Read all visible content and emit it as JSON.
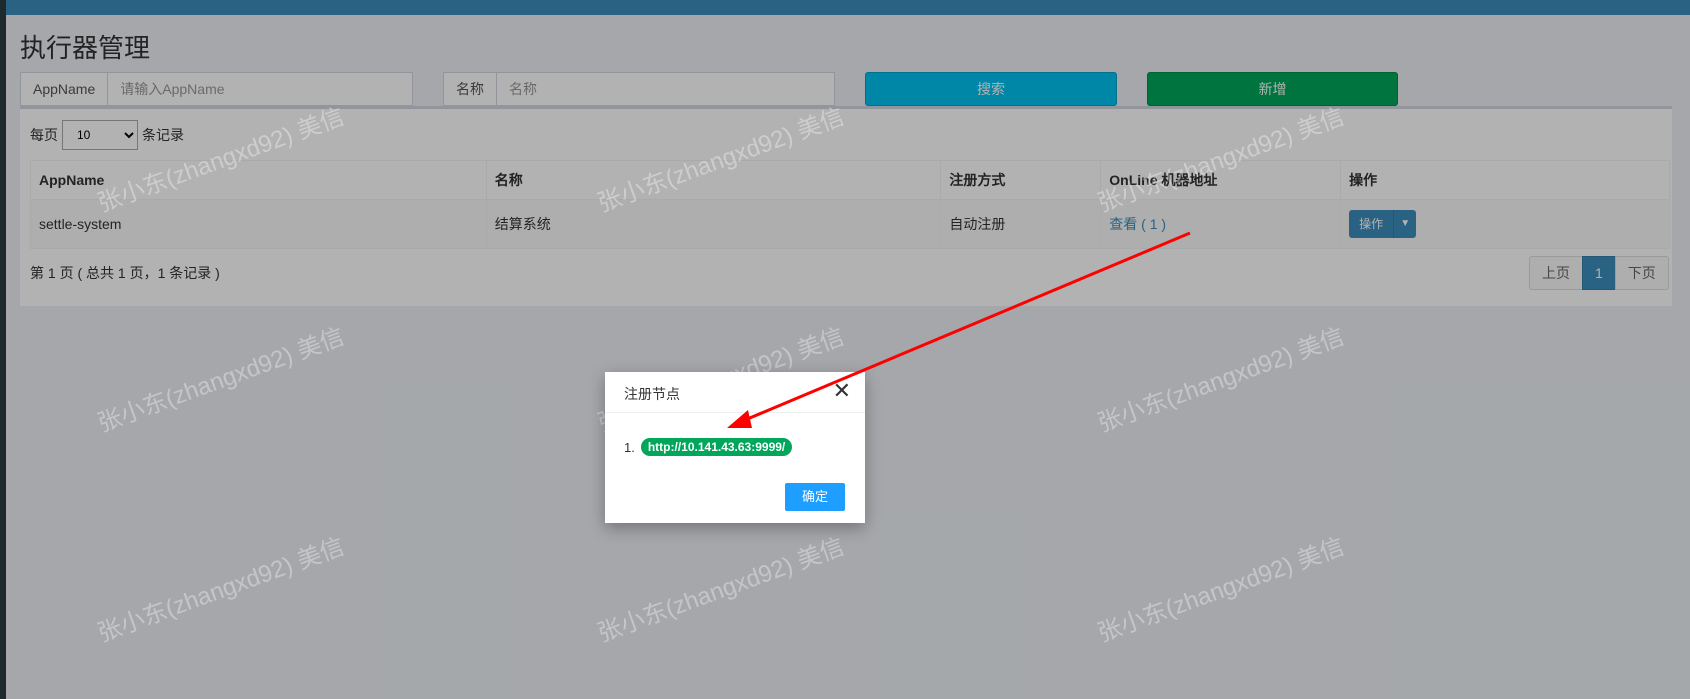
{
  "page_title": "执行器管理",
  "filters": {
    "appname_label": "AppName",
    "appname_placeholder": "请输入AppName",
    "title_label": "名称",
    "title_placeholder": "名称",
    "search_button": "搜索",
    "add_button": "新增"
  },
  "table": {
    "length_prefix": "每页",
    "length_value": "10",
    "length_suffix": "条记录",
    "headers": [
      "AppName",
      "名称",
      "注册方式",
      "OnLine 机器地址",
      "操作"
    ],
    "rows": [
      {
        "appname": "settle-system",
        "title": "结算系统",
        "register_type": "自动注册",
        "online": "查看 ( 1 )",
        "action": "操作"
      }
    ],
    "info": "第 1 页 ( 总共 1 页，1 条记录 )",
    "pagination": {
      "prev": "上页",
      "current": "1",
      "next": "下页"
    }
  },
  "modal": {
    "title": "注册节点",
    "item_index": "1.",
    "item_url": "http://10.141.43.63:9999/",
    "confirm_button": "确定"
  },
  "watermark": "张小东(zhangxd92) 美信",
  "colors": {
    "primary": "#3c8dbc",
    "search": "#00c0ef",
    "add": "#00a65a",
    "confirm": "#1e9fff",
    "arrow": "#ff0000"
  }
}
